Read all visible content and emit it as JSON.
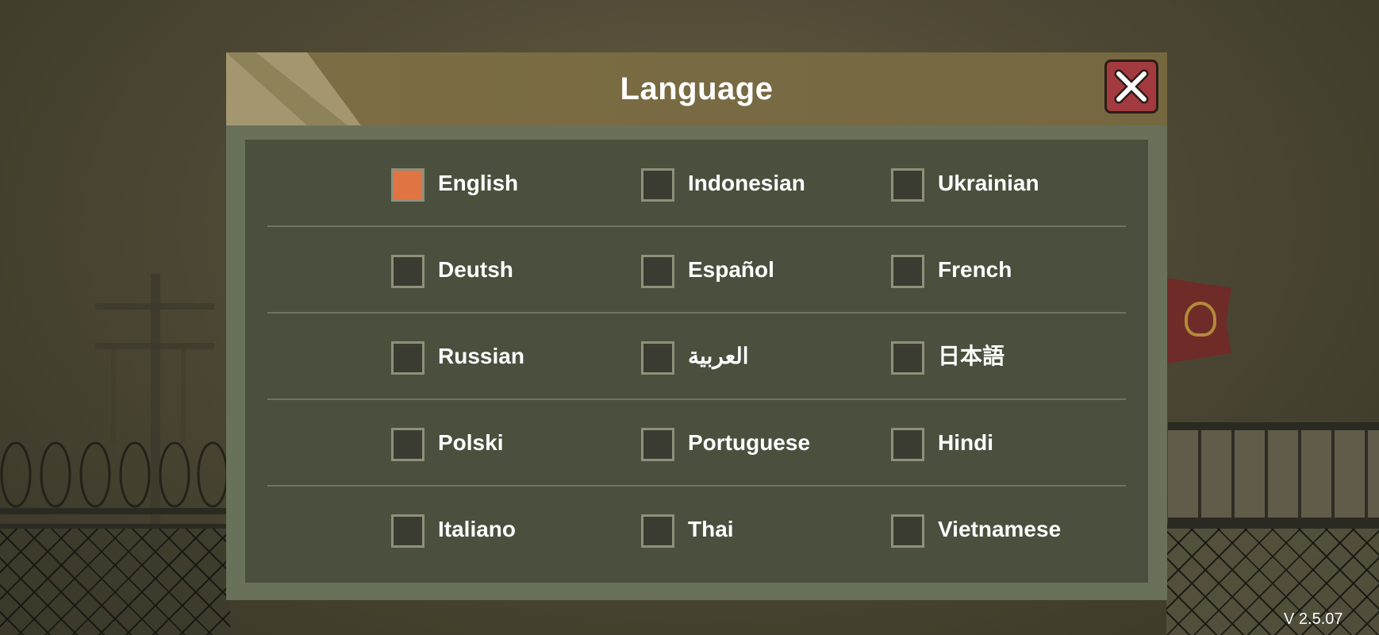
{
  "dialog": {
    "title": "Language",
    "close_icon": "close-x-icon"
  },
  "languages": {
    "rows": [
      [
        {
          "label": "English",
          "selected": true
        },
        {
          "label": "Indonesian",
          "selected": false
        },
        {
          "label": "Ukrainian",
          "selected": false
        }
      ],
      [
        {
          "label": "Deutsh",
          "selected": false
        },
        {
          "label": "Español",
          "selected": false
        },
        {
          "label": "French",
          "selected": false
        }
      ],
      [
        {
          "label": "Russian",
          "selected": false
        },
        {
          "label": "العربية",
          "selected": false
        },
        {
          "label": "日本語",
          "selected": false
        }
      ],
      [
        {
          "label": "Polski",
          "selected": false
        },
        {
          "label": "Portuguese",
          "selected": false
        },
        {
          "label": "Hindi",
          "selected": false
        }
      ],
      [
        {
          "label": "Italiano",
          "selected": false
        },
        {
          "label": "Thai",
          "selected": false
        },
        {
          "label": "Vietnamese",
          "selected": false
        }
      ]
    ]
  },
  "footer": {
    "version": "V 2.5.07"
  },
  "colors": {
    "header": "#786a42",
    "panel_outer": "#6a715b",
    "panel_inner": "#4a4f3e",
    "checkbox_selected": "#e07443",
    "close_button": "#a23a3f"
  }
}
